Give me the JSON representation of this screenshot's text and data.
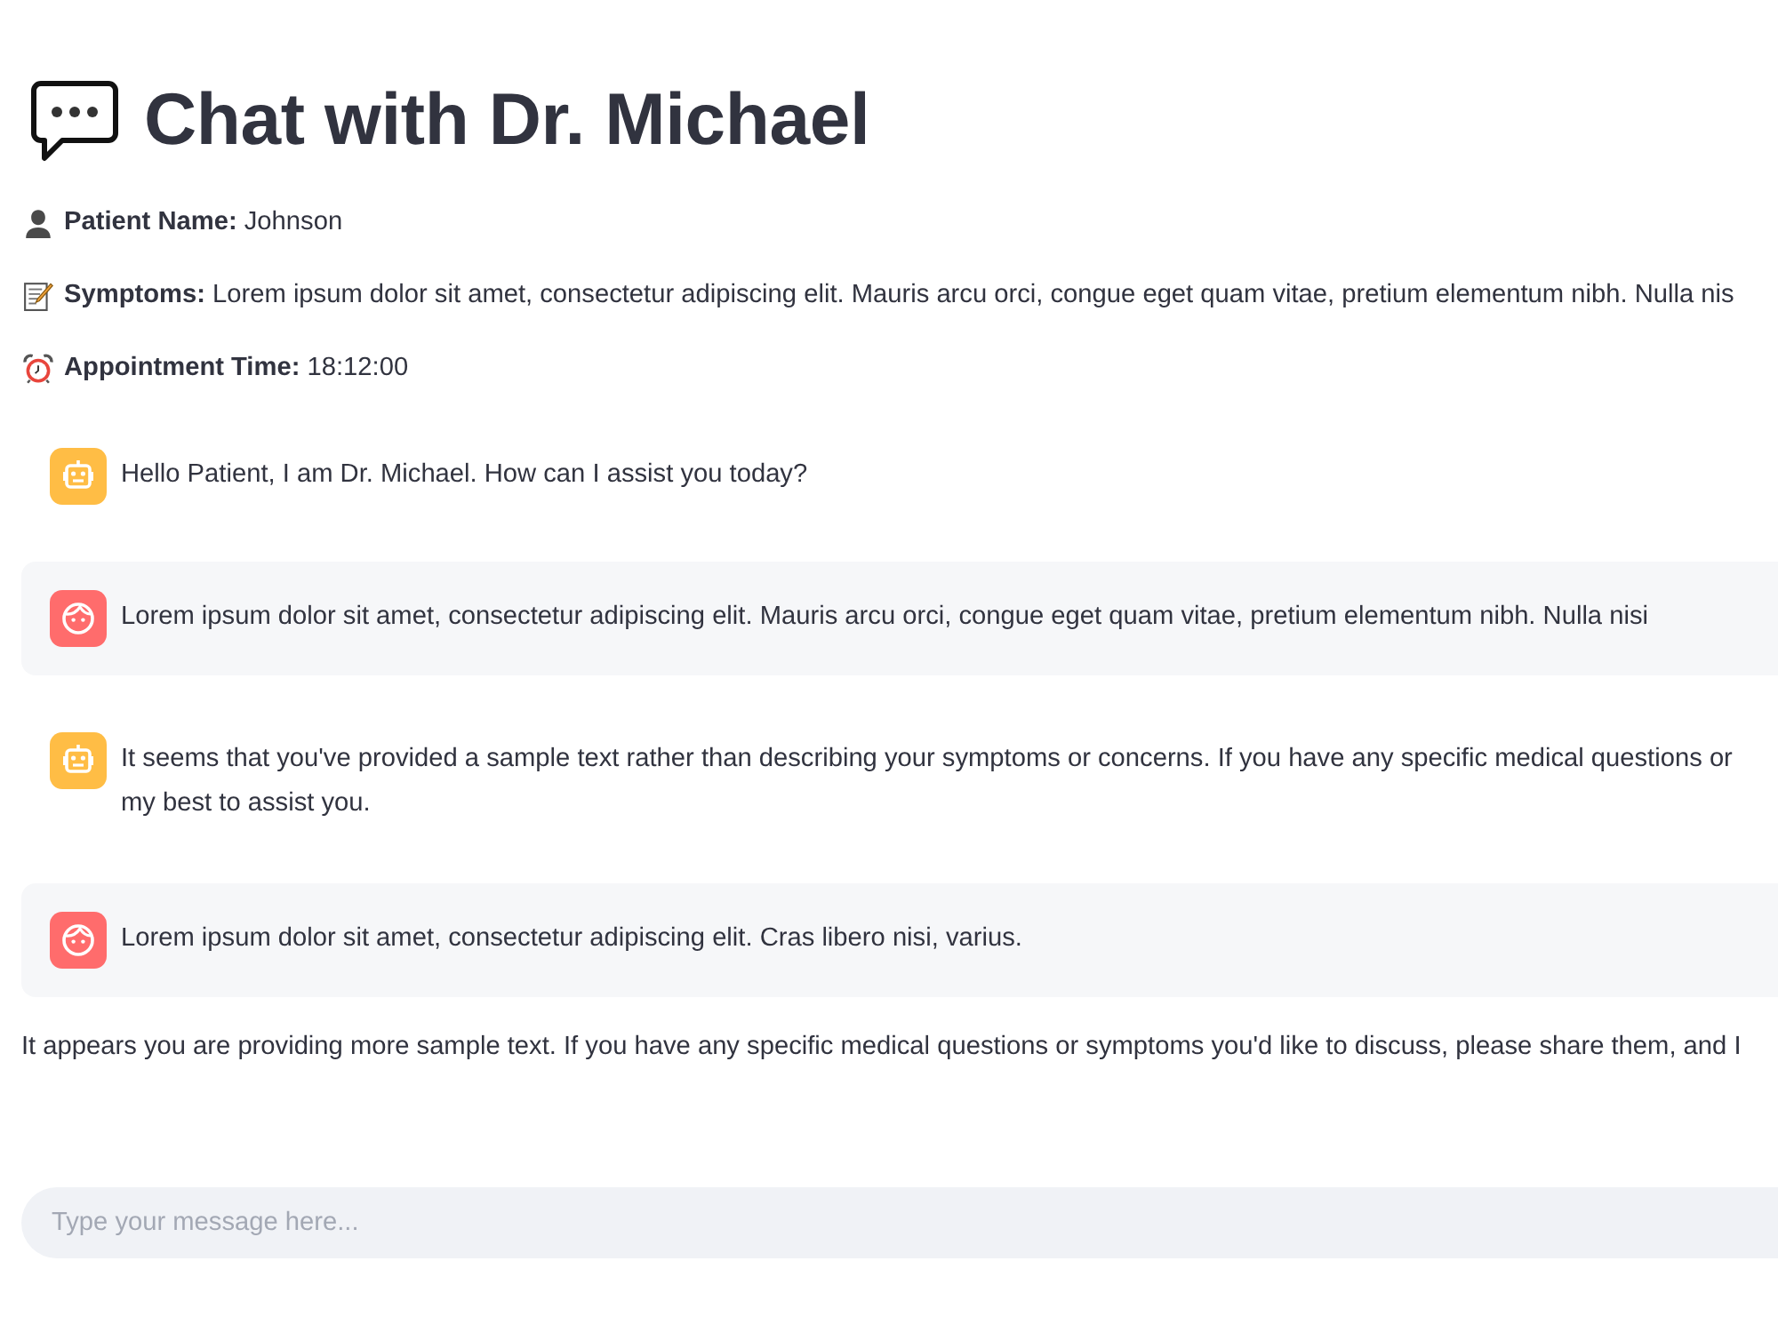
{
  "header": {
    "title": "Chat with Dr. Michael"
  },
  "patient_info": [
    {
      "kind": "person",
      "text": "**Patient Name:** Johnson"
    },
    {
      "kind": "memo",
      "text": "**Symptoms:** Lorem ipsum dolor sit amet, consectetur adipiscing elit. Mauris arcu orci, congue eget quam vitae, pretium elementum nibh. Nulla nis"
    },
    {
      "kind": "alarm",
      "text": "**Appointment Time:** 18:12:00"
    }
  ],
  "messages": [
    {
      "kind": "assistant",
      "show_avatar": true,
      "text": "Hello Patient, I am Dr. Michael. How can I assist you today?"
    },
    {
      "kind": "user",
      "show_avatar": true,
      "text": "Lorem ipsum dolor sit amet, consectetur adipiscing elit. Mauris arcu orci, congue eget quam vitae, pretium elementum nibh. Nulla nisi"
    },
    {
      "kind": "assistant",
      "show_avatar": true,
      "text": "It seems that you've provided a sample text rather than describing your symptoms or concerns. If you have any specific medical questions or\nmy best to assist you."
    },
    {
      "kind": "user",
      "show_avatar": true,
      "text": "Lorem ipsum dolor sit amet, consectetur adipiscing elit. Cras libero nisi, varius."
    },
    {
      "kind": "assistant",
      "show_avatar": false,
      "text": "It appears you are providing more sample text. If you have any specific medical questions or symptoms you'd like to discuss, please share them, and I"
    }
  ],
  "chat_input": {
    "placeholder": "Type your message here..."
  }
}
